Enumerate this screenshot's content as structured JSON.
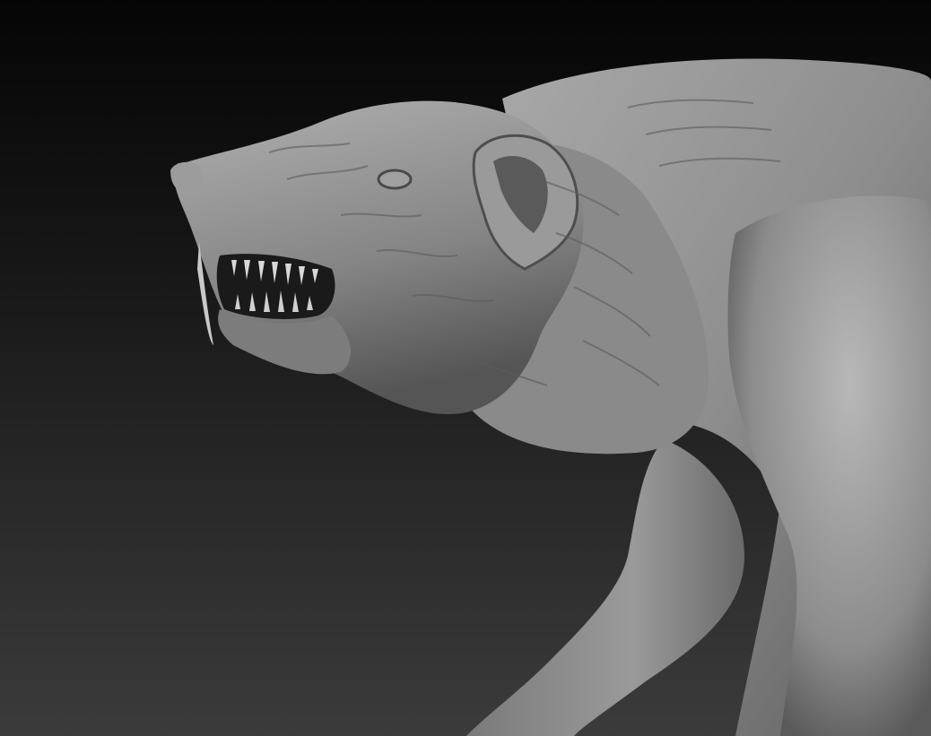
{
  "scene": {
    "subject": "creature-sculpt",
    "colors": {
      "background_top": "#050505",
      "background_bottom": "#3b3b3b",
      "skin_light": "#b4b4b4",
      "skin_mid": "#8a8a8a",
      "skin_dark": "#3c3c3c",
      "mouth_interior": "#1a1a1a",
      "teeth": "#d8d8d8"
    }
  }
}
